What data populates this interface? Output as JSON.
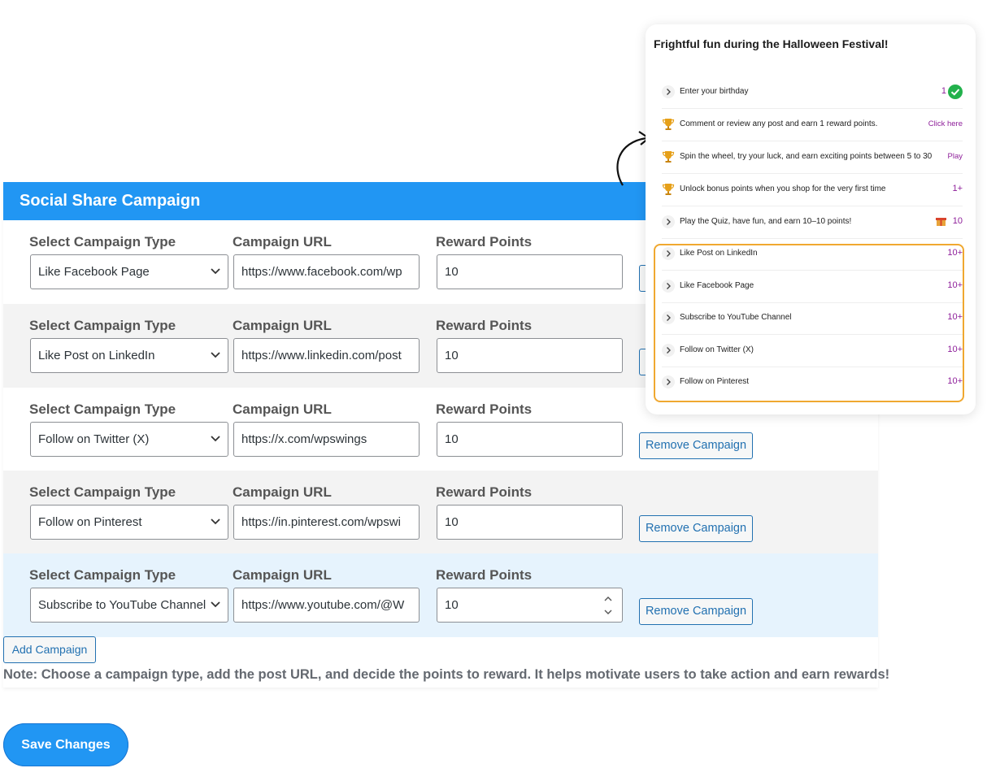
{
  "panel": {
    "title": "Social Share Campaign",
    "labels": {
      "type": "Select Campaign Type",
      "url": "Campaign URL",
      "points": "Reward Points"
    },
    "remove_label": "Remove Campaign",
    "rows": [
      {
        "type": "Like Facebook Page",
        "url": "https://www.facebook.com/wp",
        "points": "10"
      },
      {
        "type": "Like Post on LinkedIn",
        "url": "https://www.linkedin.com/post",
        "points": "10"
      },
      {
        "type": "Follow on Twitter (X)",
        "url": "https://x.com/wpswings",
        "points": "10"
      },
      {
        "type": "Follow on Pinterest",
        "url": "https://in.pinterest.com/wpswi",
        "points": "10"
      },
      {
        "type": "Subscribe to YouTube Channel",
        "url": "https://www.youtube.com/@W",
        "points": "10"
      }
    ],
    "add_label": "Add Campaign",
    "note": "Note: Choose a campaign type, add the post URL, and decide the points to reward. It helps motivate users to take action and earn rewards!"
  },
  "save_label": "Save Changes",
  "card": {
    "title": "Frightful fun during the Halloween Festival!",
    "items": [
      {
        "icon": "chevron-right-icon",
        "text": "Enter your birthday",
        "right": "1",
        "check": true
      },
      {
        "icon": "trophy-icon",
        "text": "Comment or review any post and earn 1 reward points.",
        "right": "Click here"
      },
      {
        "icon": "trophy-icon",
        "text": "Spin the wheel, try your luck, and earn exciting points between 5 to 30",
        "right": "Play"
      },
      {
        "icon": "trophy-icon",
        "text": "Unlock bonus points when you shop for the very first time",
        "right": "1+"
      },
      {
        "icon": "chevron-right-icon",
        "text": "Play the Quiz, have fun, and earn 10–10 points!",
        "right": "10",
        "gift": true
      },
      {
        "icon": "chevron-right-icon",
        "text": "Like Post on LinkedIn",
        "right": "10+"
      },
      {
        "icon": "chevron-right-icon",
        "text": "Like Facebook Page",
        "right": "10+"
      },
      {
        "icon": "chevron-right-icon",
        "text": "Subscribe to YouTube Channel",
        "right": "10+"
      },
      {
        "icon": "chevron-right-icon",
        "text": "Follow on Twitter (X)",
        "right": "10+"
      },
      {
        "icon": "chevron-right-icon",
        "text": "Follow on Pinterest",
        "right": "10+"
      }
    ]
  },
  "colors": {
    "header": "#2196f3",
    "accent_link": "#2271b1",
    "points_purple": "#8e1f9a",
    "highlight": "#f0a830",
    "check_green": "#22b14c"
  }
}
